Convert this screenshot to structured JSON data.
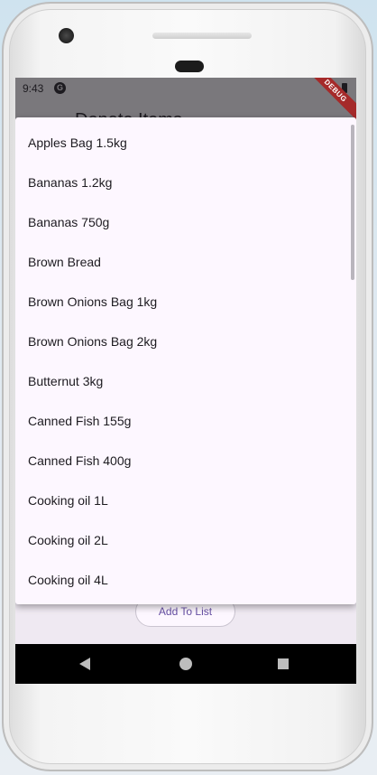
{
  "status_bar": {
    "time": "9:43",
    "g_glyph": "G"
  },
  "app_bar": {
    "title": "Donate Items",
    "back_icon": "arrow-back-icon"
  },
  "debug_banner": "DEBUG",
  "dropdown": {
    "items": [
      "Apples Bag 1.5kg",
      "Bananas 1.2kg",
      "Bananas 750g",
      "Brown Bread",
      "Brown Onions Bag 1kg",
      "Brown Onions Bag 2kg",
      "Butternut 3kg",
      "Canned Fish 155g",
      "Canned Fish 400g",
      "Cooking oil 1L",
      "Cooking oil 2L",
      "Cooking oil 4L"
    ]
  },
  "actions": {
    "add_to_list": "Add To List"
  },
  "nav": {
    "back_icon": "nav-back-icon",
    "home_icon": "nav-home-icon",
    "recent_icon": "nav-recents-icon"
  },
  "colors": {
    "accent": "#6750a4",
    "surface": "#fdf7ff",
    "scrim": "#7a787c",
    "debug": "#a52a2a"
  }
}
